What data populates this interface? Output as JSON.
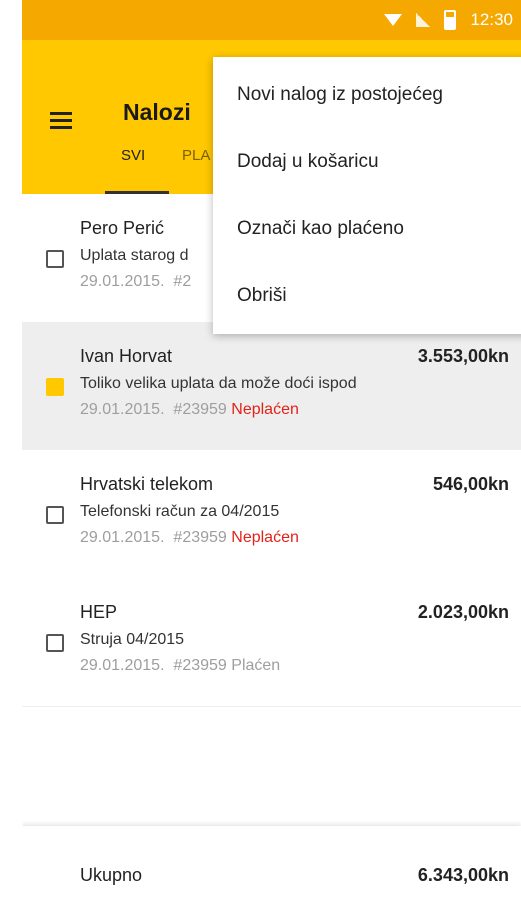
{
  "status_bar": {
    "time": "12:30"
  },
  "app_bar": {
    "title": "Nalozi",
    "tabs": [
      {
        "label": "SVI",
        "selected": true
      },
      {
        "label": "PLA",
        "selected": false
      }
    ]
  },
  "orders": [
    {
      "name": "Pero Perić",
      "amount": "",
      "description": "Uplata starog d",
      "date": "29.01.2015.",
      "number": "#2",
      "status": "",
      "checked": false
    },
    {
      "name": "Ivan Horvat",
      "amount": "3.553,00kn",
      "description": "Toliko velika uplata da može doći ispod",
      "date": "29.01.2015.",
      "number": "#23959",
      "status": "Neplaćen",
      "checked": true
    },
    {
      "name": "Hrvatski telekom",
      "amount": "546,00kn",
      "description": "Telefonski račun za 04/2015",
      "date": "29.01.2015.",
      "number": "#23959",
      "status": "Neplaćen",
      "checked": false
    },
    {
      "name": "HEP",
      "amount": "2.023,00kn",
      "description": "Struja 04/2015",
      "date": "29.01.2015.",
      "number": "#23959",
      "status": "Plaćen",
      "checked": false
    }
  ],
  "footer": {
    "label": "Ukupno",
    "total": "6.343,00kn"
  },
  "overflow_menu": {
    "items": [
      "Novi nalog iz postojećeg",
      "Dodaj u košaricu",
      "Označi kao plaćeno",
      "Obriši"
    ]
  },
  "colors": {
    "status_bar": "#f5a800",
    "app_bar": "#ffc800",
    "unpaid": "#e2231a",
    "checkbox_checked": "#ffc800"
  }
}
